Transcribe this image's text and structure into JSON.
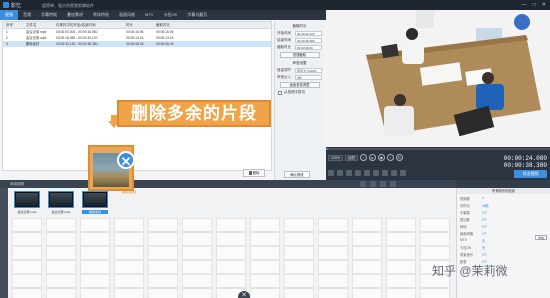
{
  "app": {
    "name": "影忆",
    "document": "超简单、强大的视频剪辑软件"
  },
  "window": {
    "controls": [
      "—",
      "□",
      "✕"
    ]
  },
  "tabs": [
    "视频",
    "音频",
    "字幕特效",
    "叠加素材",
    "转场特效",
    "画面风格",
    "MTV",
    "卡拉OK",
    "字幕与翻页"
  ],
  "file_list": {
    "columns": [
      "序号",
      "文件名",
      "在素材中的开始/结束时间",
      "时长",
      "截取时长"
    ],
    "rows": [
      {
        "index": "1",
        "name": "会议记录.mp4",
        "range": "00:00:00.000 - 00:00:16.960",
        "duration": "00:00:16.96",
        "cut": "00:00:16.96"
      },
      {
        "index": "2",
        "name": "会议记录.mp4",
        "range": "00:00:16.960 - 00:00:30.120",
        "duration": "00:00:13.16",
        "cut": "00:00:13.16"
      },
      {
        "index": "3",
        "name": "删除素材",
        "range": "00:00:30.120 - 00:00:38.380",
        "duration": "00:00:08.26",
        "cut": "00:00:08.26"
      }
    ],
    "selected_row": 2
  },
  "props": {
    "section1": "截取时长",
    "start_label": "开始时间",
    "start_value": "00:00:30.120",
    "end_label": "结束时间",
    "end_value": "00:00:38.380",
    "duration_label": "截取时长",
    "duration_value": "00:00:08.26",
    "btn_pick": "快捷截取",
    "section2": "声音设置",
    "volume_label": "音量调节",
    "volume_value": "原声大小100%",
    "fade_label": "声音淡入",
    "fade_value": "0秒",
    "btn_edit": "画面音量调整",
    "checkbox_label": "从视频中剪切",
    "confirm": "确认修改"
  },
  "delete_button": "删除",
  "callout": "删除多余的片段",
  "player": {
    "zoom": "100%",
    "zoom_mode": "适配",
    "time_current": "00:00:24.080",
    "time_total": "00:00:38.380",
    "seek_percent": 1
  },
  "timeline": {
    "tool_label": "添加视频",
    "clips": [
      {
        "label": "会议记录.mp4",
        "selected": false
      },
      {
        "label": "会议记录.mp4",
        "selected": false
      },
      {
        "label": "删除素材",
        "selected": true
      }
    ],
    "drag_source_label": "删除素材"
  },
  "export": "导出视频",
  "right_panel": {
    "title": "所有制作的信息",
    "rows": [
      {
        "k": "视频数",
        "v": "3"
      },
      {
        "k": "总时长",
        "v": "38秒"
      },
      {
        "k": "字幕数",
        "v": "0个"
      },
      {
        "k": "叠加数",
        "v": "0个"
      },
      {
        "k": "转场",
        "v": "0个"
      },
      {
        "k": "画面风格",
        "v": "0个"
      },
      {
        "k": "MTV",
        "v": "无"
      },
      {
        "k": "卡拉OK",
        "v": "无"
      },
      {
        "k": "背景音乐",
        "v": "0个"
      },
      {
        "k": "配音",
        "v": "0个"
      }
    ],
    "btn": "详情"
  },
  "watermark": "知乎 @茉莉微",
  "colors": {
    "accent": "#3c8fe0",
    "callout": "#f0a449",
    "dark": "#333d49"
  }
}
